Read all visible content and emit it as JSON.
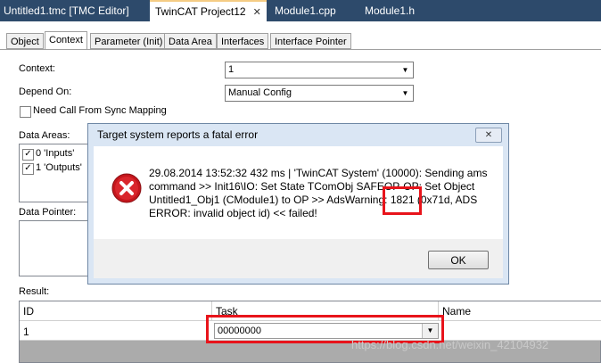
{
  "doc_tabs": [
    {
      "label": "Untitled1.tmc [TMC Editor]"
    },
    {
      "label": "TwinCAT Project12"
    },
    {
      "label": "Module1.cpp"
    },
    {
      "label": "Module1.h"
    }
  ],
  "prop_tabs": [
    "Object",
    "Context",
    "Parameter (Init)",
    "Data Area",
    "Interfaces",
    "Interface Pointer"
  ],
  "form": {
    "context_label": "Context:",
    "context_value": "1",
    "depend_label": "Depend On:",
    "depend_value": "Manual Config",
    "sync_label": "Need Call From Sync Mapping",
    "data_areas_label": "Data Areas:",
    "data_areas": [
      "0 'Inputs'",
      "1 'Outputs'"
    ],
    "data_pointer_label": "Data Pointer:",
    "result_label": "Result:"
  },
  "grid": {
    "headers": {
      "id": "ID",
      "task": "Task",
      "name": "Name"
    },
    "row": {
      "id": "1",
      "task": "00000000"
    }
  },
  "dialog": {
    "title": "Target system reports a fatal error",
    "message_1": "29.08.2014 13:52:32 432 ms | 'TwinCAT System' (10000): Sending ams",
    "message_2": "command >> Init16\\IO: Set State TComObj SAFEOP-OP: Set Object",
    "message_3a": "Untitled1_Obj1 (CModule1) to OP >> AdsWarning: ",
    "message_3b": "1821",
    "message_3c": " (0x71d, ADS",
    "message_4": "ERROR: invalid object id) << failed!",
    "ok_label": "OK"
  },
  "watermark": "https://blog.csdn.net/weixin_42104932",
  "colors": {
    "tab_strip": "#2d4a6b",
    "highlight": "#e8141b",
    "dialog_frame": "#dae6f4"
  }
}
